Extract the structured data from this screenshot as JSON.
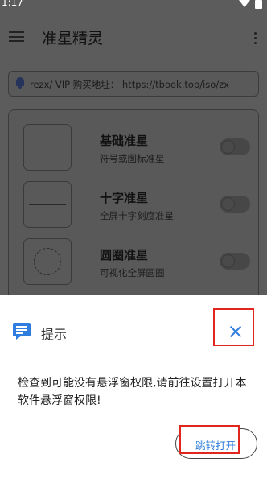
{
  "status_bar": {
    "time": "1:17"
  },
  "app_bar": {
    "title": "准星精灵"
  },
  "notice": {
    "text": "rezx/ VIP 购买地址： https://tbook.top/iso/zx"
  },
  "crosshairs": [
    {
      "title": "基础准星",
      "subtitle": "符号或图标准星",
      "icon": "dot-crosshair-icon",
      "enabled": false
    },
    {
      "title": "十字准星",
      "subtitle": "全屏十字刻度准星",
      "icon": "cross-crosshair-icon",
      "enabled": false
    },
    {
      "title": "圆圈准星",
      "subtitle": "可视化全屏圆圈",
      "icon": "circle-crosshair-icon",
      "enabled": false
    }
  ],
  "dialog": {
    "title": "提示",
    "message": "检查到可能没有悬浮窗权限,请前往设置打开本软件悬浮窗权限!",
    "confirm_label": "跳转打开"
  },
  "colors": {
    "accent": "#2f7dde",
    "highlight": "#e0261d",
    "scrim": "#5c5c5c"
  }
}
